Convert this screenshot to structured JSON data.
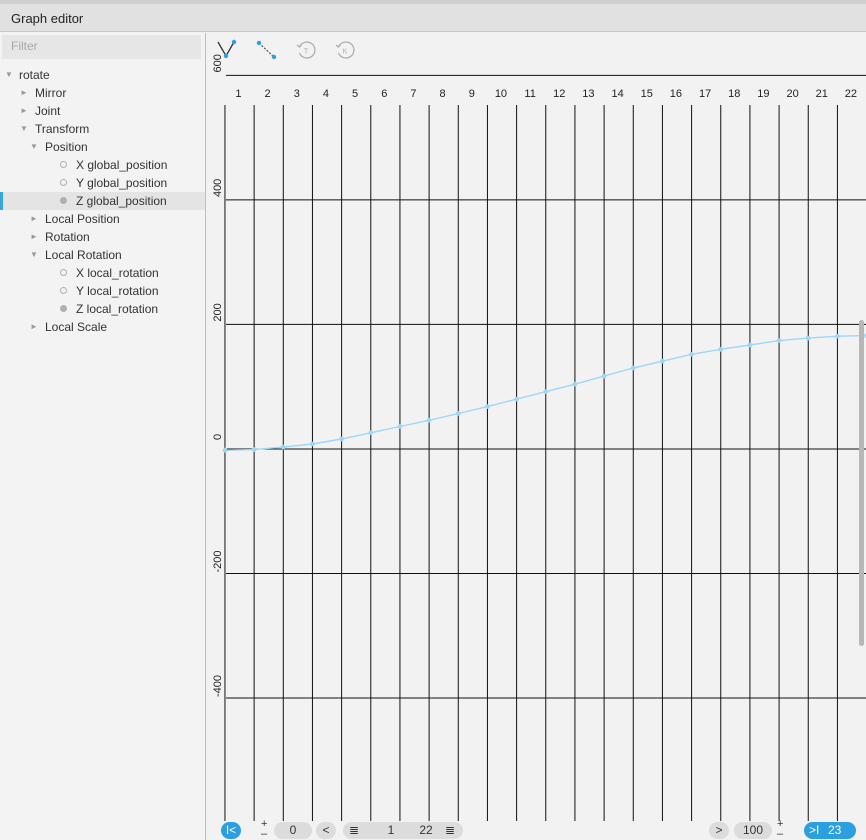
{
  "window": {
    "title": "Graph editor"
  },
  "filter": {
    "placeholder": "Filter"
  },
  "tree": [
    {
      "label": "rotate",
      "depth": 0,
      "arrow": "▼"
    },
    {
      "label": "Mirror",
      "depth": 1,
      "arrow": "►"
    },
    {
      "label": "Joint",
      "depth": 1,
      "arrow": "►"
    },
    {
      "label": "Transform",
      "depth": 1,
      "arrow": "▼"
    },
    {
      "label": "Position",
      "depth": 2,
      "arrow": "▼"
    },
    {
      "label": "X global_position",
      "depth": 3,
      "dot": "empty"
    },
    {
      "label": "Y global_position",
      "depth": 3,
      "dot": "empty"
    },
    {
      "label": "Z global_position",
      "depth": 3,
      "dot": "fill",
      "selected": true
    },
    {
      "label": "Local Position",
      "depth": 2,
      "arrow": "►"
    },
    {
      "label": "Rotation",
      "depth": 2,
      "arrow": "►"
    },
    {
      "label": "Local Rotation",
      "depth": 2,
      "arrow": "▼"
    },
    {
      "label": "X local_rotation",
      "depth": 3,
      "dot": "empty"
    },
    {
      "label": "Y local_rotation",
      "depth": 3,
      "dot": "empty"
    },
    {
      "label": "Z local_rotation",
      "depth": 3,
      "dot": "fill"
    },
    {
      "label": "Local Scale",
      "depth": 2,
      "arrow": "►"
    }
  ],
  "toolbar": {
    "icons": [
      "curve-vertex-icon",
      "curve-segment-icon",
      "tangent-undo-icon",
      "key-undo-icon"
    ],
    "tangent_glyph": "T",
    "key_glyph": "K"
  },
  "bottombar": {
    "first_value": "0",
    "range_start": "1",
    "range_end": "22",
    "zoom": "100",
    "last_frame": "23",
    "first_key_glyph": "I<",
    "prev_glyph": "<",
    "next_glyph": ">",
    "last_key_glyph": ">I",
    "list_glyph": "≣",
    "plus_glyph": "+",
    "minus_glyph": "–"
  },
  "colors": {
    "accent": "#2b9fe0",
    "curve": "#9fd6f5",
    "grid": "#111111"
  },
  "chart_data": {
    "type": "line",
    "xlabel": "",
    "ylabel": "",
    "x": [
      1,
      2,
      3,
      4,
      5,
      6,
      7,
      8,
      9,
      10,
      11,
      12,
      13,
      14,
      15,
      16,
      17,
      18,
      19,
      20,
      21,
      22,
      23
    ],
    "series": [
      {
        "values": [
          -2,
          -1,
          3,
          8,
          16,
          26,
          36,
          46,
          57,
          68,
          80,
          92,
          104,
          117,
          130,
          141,
          152,
          160,
          167,
          174,
          178,
          181,
          182
        ]
      }
    ],
    "x_ticks": [
      "1",
      "2",
      "3",
      "4",
      "5",
      "6",
      "7",
      "8",
      "9",
      "10",
      "11",
      "12",
      "13",
      "14",
      "15",
      "16",
      "17",
      "18",
      "19",
      "20",
      "21",
      "22"
    ],
    "y_ticks": [
      "600",
      "400",
      "200",
      "0",
      "-200",
      "-400"
    ],
    "y_tick_values": [
      600,
      400,
      200,
      0,
      -200,
      -400
    ],
    "xlim": [
      0.35,
      22.98
    ],
    "ylim": [
      -628,
      668
    ],
    "grid": true
  }
}
